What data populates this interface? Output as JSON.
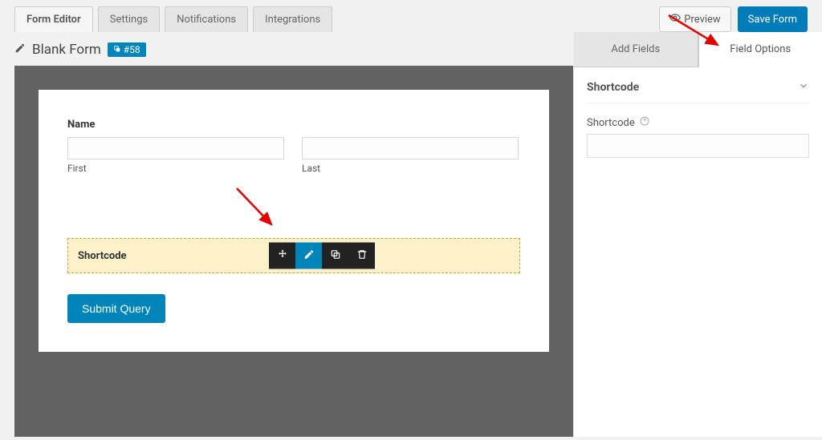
{
  "tabs": {
    "form_editor": "Form Editor",
    "settings": "Settings",
    "notifications": "Notifications",
    "integrations": "Integrations"
  },
  "header": {
    "preview_label": "Preview",
    "save_label": "Save Form"
  },
  "form": {
    "title": "Blank Form",
    "id_badge": "#58"
  },
  "name_field": {
    "label": "Name",
    "first_sub": "First",
    "last_sub": "Last"
  },
  "selected_field": {
    "label": "Shortcode",
    "icons": {
      "move": "move-icon",
      "edit": "pencil-icon",
      "duplicate": "duplicate-icon",
      "delete": "trash-icon"
    }
  },
  "submit": {
    "label": "Submit Query"
  },
  "side_tabs": {
    "add_fields": "Add Fields",
    "field_options": "Field Options"
  },
  "panel": {
    "title": "Shortcode",
    "input_label": "Shortcode",
    "input_value": ""
  }
}
